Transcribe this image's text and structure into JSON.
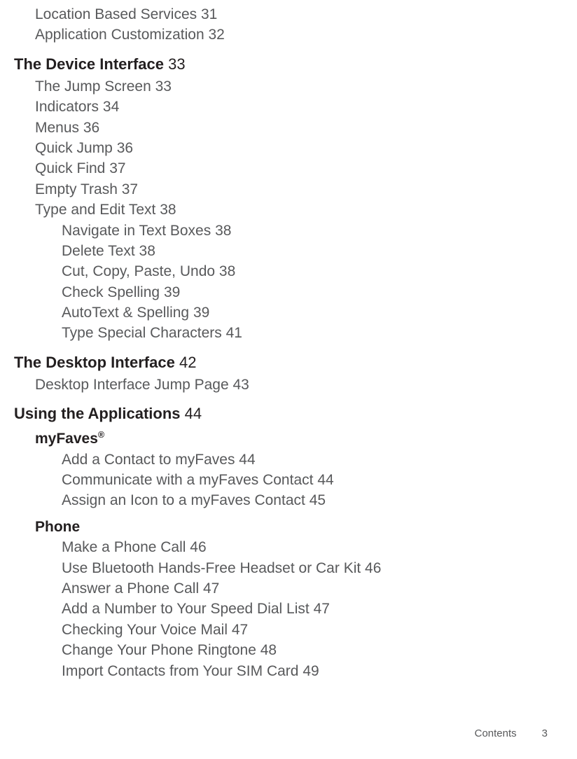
{
  "orphan_items": [
    {
      "label": "Location Based Services",
      "page": "31"
    },
    {
      "label": "Application Customization",
      "page": "32"
    }
  ],
  "sections": [
    {
      "heading": "The Device Interface",
      "page": "33",
      "items": [
        {
          "label": "The Jump Screen",
          "page": "33"
        },
        {
          "label": "Indicators",
          "page": "34"
        },
        {
          "label": "Menus",
          "page": "36"
        },
        {
          "label": "Quick Jump",
          "page": "36"
        },
        {
          "label": "Quick Find",
          "page": "37"
        },
        {
          "label": "Empty Trash",
          "page": "37"
        },
        {
          "label": "Type and Edit Text",
          "page": "38",
          "subitems": [
            {
              "label": "Navigate in Text Boxes",
              "page": "38"
            },
            {
              "label": "Delete Text",
              "page": "38"
            },
            {
              "label": "Cut, Copy, Paste, Undo",
              "page": "38"
            },
            {
              "label": "Check Spelling",
              "page": "39"
            },
            {
              "label": "AutoText & Spelling",
              "page": "39"
            },
            {
              "label": "Type Special Characters",
              "page": "41"
            }
          ]
        }
      ]
    },
    {
      "heading": "The Desktop Interface",
      "page": "42",
      "items": [
        {
          "label": "Desktop Interface Jump Page",
          "page": "43"
        }
      ]
    },
    {
      "heading": "Using the Applications",
      "page": "44",
      "subsections": [
        {
          "title": "myFaves",
          "trademark": "®",
          "items": [
            {
              "label": "Add a Contact to myFaves",
              "page": "44"
            },
            {
              "label": "Communicate with a myFaves Contact",
              "page": "44"
            },
            {
              "label": "Assign an Icon to a myFaves Contact",
              "page": "45"
            }
          ]
        },
        {
          "title": "Phone",
          "items": [
            {
              "label": "Make a Phone Call",
              "page": "46"
            },
            {
              "label": "Use Bluetooth Hands-Free Headset or Car Kit",
              "page": "46"
            },
            {
              "label": "Answer a Phone Call",
              "page": "47"
            },
            {
              "label": "Add a Number to Your Speed Dial List",
              "page": "47"
            },
            {
              "label": "Checking Your Voice Mail",
              "page": "47"
            },
            {
              "label": "Change Your Phone Ringtone",
              "page": "48"
            },
            {
              "label": "Import Contacts from Your SIM Card",
              "page": "49"
            }
          ]
        }
      ]
    }
  ],
  "footer": {
    "label": "Contents",
    "page": "3"
  }
}
